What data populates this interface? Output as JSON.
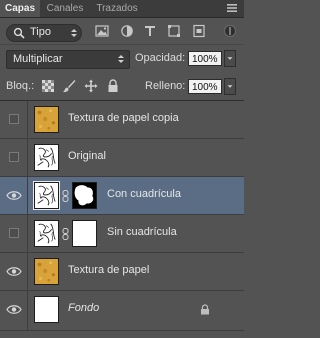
{
  "tabs": [
    {
      "label": "Capas",
      "active": true
    },
    {
      "label": "Canales",
      "active": false
    },
    {
      "label": "Trazados",
      "active": false
    }
  ],
  "filter": {
    "kind_label": "Tipo"
  },
  "blend": {
    "mode": "Multiplicar"
  },
  "opacity": {
    "label": "Opacidad:",
    "value": "100%"
  },
  "fill": {
    "label": "Relleno:",
    "value": "100%"
  },
  "lock": {
    "label": "Bloq.:"
  },
  "layers": [
    {
      "name": "Textura de papel copia",
      "visible": false,
      "thumb": "paper",
      "mask": false,
      "selected": false,
      "italic": false
    },
    {
      "name": "Original",
      "visible": false,
      "thumb": "sketch",
      "mask": false,
      "selected": false,
      "italic": false
    },
    {
      "name": "Con cuadrícula",
      "visible": true,
      "thumb": "sketch",
      "mask": "shape",
      "selected": true,
      "italic": false
    },
    {
      "name": "Sin cuadrícula",
      "visible": false,
      "thumb": "sketch",
      "mask": "white",
      "selected": false,
      "italic": false
    },
    {
      "name": "Textura de papel",
      "visible": true,
      "thumb": "paper",
      "mask": false,
      "selected": false,
      "italic": false
    },
    {
      "name": "Fondo",
      "visible": true,
      "thumb": "white",
      "mask": false,
      "selected": false,
      "italic": true,
      "locked": true
    }
  ],
  "colors": {
    "panel": "#535353",
    "selected_row": "#5a6d85",
    "paper_texture": "#d8a33a"
  }
}
